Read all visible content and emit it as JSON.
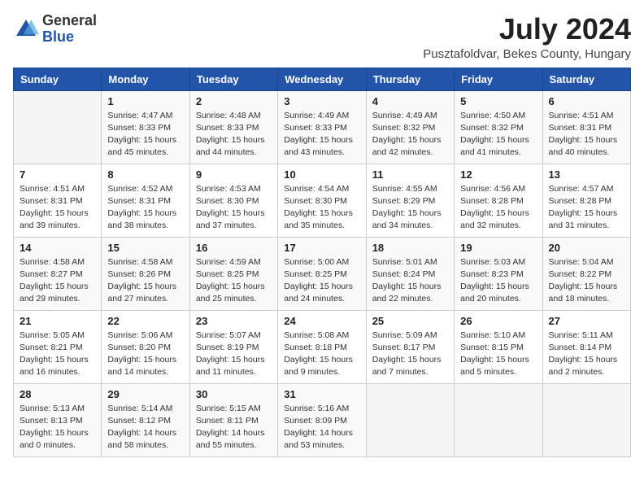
{
  "header": {
    "logo": {
      "general": "General",
      "blue": "Blue"
    },
    "title": "July 2024",
    "location": "Pusztafoldvar, Bekes County, Hungary"
  },
  "weekdays": [
    "Sunday",
    "Monday",
    "Tuesday",
    "Wednesday",
    "Thursday",
    "Friday",
    "Saturday"
  ],
  "weeks": [
    [
      {
        "day": "",
        "content": ""
      },
      {
        "day": "1",
        "content": "Sunrise: 4:47 AM\nSunset: 8:33 PM\nDaylight: 15 hours\nand 45 minutes."
      },
      {
        "day": "2",
        "content": "Sunrise: 4:48 AM\nSunset: 8:33 PM\nDaylight: 15 hours\nand 44 minutes."
      },
      {
        "day": "3",
        "content": "Sunrise: 4:49 AM\nSunset: 8:33 PM\nDaylight: 15 hours\nand 43 minutes."
      },
      {
        "day": "4",
        "content": "Sunrise: 4:49 AM\nSunset: 8:32 PM\nDaylight: 15 hours\nand 42 minutes."
      },
      {
        "day": "5",
        "content": "Sunrise: 4:50 AM\nSunset: 8:32 PM\nDaylight: 15 hours\nand 41 minutes."
      },
      {
        "day": "6",
        "content": "Sunrise: 4:51 AM\nSunset: 8:31 PM\nDaylight: 15 hours\nand 40 minutes."
      }
    ],
    [
      {
        "day": "7",
        "content": "Sunrise: 4:51 AM\nSunset: 8:31 PM\nDaylight: 15 hours\nand 39 minutes."
      },
      {
        "day": "8",
        "content": "Sunrise: 4:52 AM\nSunset: 8:31 PM\nDaylight: 15 hours\nand 38 minutes."
      },
      {
        "day": "9",
        "content": "Sunrise: 4:53 AM\nSunset: 8:30 PM\nDaylight: 15 hours\nand 37 minutes."
      },
      {
        "day": "10",
        "content": "Sunrise: 4:54 AM\nSunset: 8:30 PM\nDaylight: 15 hours\nand 35 minutes."
      },
      {
        "day": "11",
        "content": "Sunrise: 4:55 AM\nSunset: 8:29 PM\nDaylight: 15 hours\nand 34 minutes."
      },
      {
        "day": "12",
        "content": "Sunrise: 4:56 AM\nSunset: 8:28 PM\nDaylight: 15 hours\nand 32 minutes."
      },
      {
        "day": "13",
        "content": "Sunrise: 4:57 AM\nSunset: 8:28 PM\nDaylight: 15 hours\nand 31 minutes."
      }
    ],
    [
      {
        "day": "14",
        "content": "Sunrise: 4:58 AM\nSunset: 8:27 PM\nDaylight: 15 hours\nand 29 minutes."
      },
      {
        "day": "15",
        "content": "Sunrise: 4:58 AM\nSunset: 8:26 PM\nDaylight: 15 hours\nand 27 minutes."
      },
      {
        "day": "16",
        "content": "Sunrise: 4:59 AM\nSunset: 8:25 PM\nDaylight: 15 hours\nand 25 minutes."
      },
      {
        "day": "17",
        "content": "Sunrise: 5:00 AM\nSunset: 8:25 PM\nDaylight: 15 hours\nand 24 minutes."
      },
      {
        "day": "18",
        "content": "Sunrise: 5:01 AM\nSunset: 8:24 PM\nDaylight: 15 hours\nand 22 minutes."
      },
      {
        "day": "19",
        "content": "Sunrise: 5:03 AM\nSunset: 8:23 PM\nDaylight: 15 hours\nand 20 minutes."
      },
      {
        "day": "20",
        "content": "Sunrise: 5:04 AM\nSunset: 8:22 PM\nDaylight: 15 hours\nand 18 minutes."
      }
    ],
    [
      {
        "day": "21",
        "content": "Sunrise: 5:05 AM\nSunset: 8:21 PM\nDaylight: 15 hours\nand 16 minutes."
      },
      {
        "day": "22",
        "content": "Sunrise: 5:06 AM\nSunset: 8:20 PM\nDaylight: 15 hours\nand 14 minutes."
      },
      {
        "day": "23",
        "content": "Sunrise: 5:07 AM\nSunset: 8:19 PM\nDaylight: 15 hours\nand 11 minutes."
      },
      {
        "day": "24",
        "content": "Sunrise: 5:08 AM\nSunset: 8:18 PM\nDaylight: 15 hours\nand 9 minutes."
      },
      {
        "day": "25",
        "content": "Sunrise: 5:09 AM\nSunset: 8:17 PM\nDaylight: 15 hours\nand 7 minutes."
      },
      {
        "day": "26",
        "content": "Sunrise: 5:10 AM\nSunset: 8:15 PM\nDaylight: 15 hours\nand 5 minutes."
      },
      {
        "day": "27",
        "content": "Sunrise: 5:11 AM\nSunset: 8:14 PM\nDaylight: 15 hours\nand 2 minutes."
      }
    ],
    [
      {
        "day": "28",
        "content": "Sunrise: 5:13 AM\nSunset: 8:13 PM\nDaylight: 15 hours\nand 0 minutes."
      },
      {
        "day": "29",
        "content": "Sunrise: 5:14 AM\nSunset: 8:12 PM\nDaylight: 14 hours\nand 58 minutes."
      },
      {
        "day": "30",
        "content": "Sunrise: 5:15 AM\nSunset: 8:11 PM\nDaylight: 14 hours\nand 55 minutes."
      },
      {
        "day": "31",
        "content": "Sunrise: 5:16 AM\nSunset: 8:09 PM\nDaylight: 14 hours\nand 53 minutes."
      },
      {
        "day": "",
        "content": ""
      },
      {
        "day": "",
        "content": ""
      },
      {
        "day": "",
        "content": ""
      }
    ]
  ]
}
